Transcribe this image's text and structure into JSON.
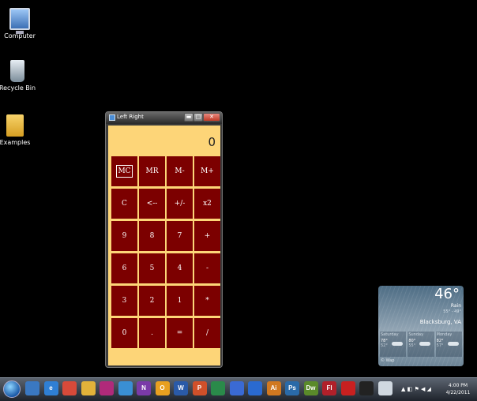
{
  "desktop": {
    "icons": [
      {
        "label": "Computer"
      },
      {
        "label": "Recycle Bin"
      },
      {
        "label": "Examples"
      }
    ]
  },
  "window": {
    "title": "Left Right",
    "min_symbol": "▬",
    "max_symbol": "□",
    "close_symbol": "✕",
    "display_value": "0",
    "keys": [
      "MC",
      "MR",
      "M-",
      "M+",
      "C",
      "<--",
      "+/-",
      "x2",
      "9",
      "8",
      "7",
      "+",
      "6",
      "5",
      "4",
      "-",
      "3",
      "2",
      "1",
      "*",
      "0",
      ".",
      "=",
      "/"
    ],
    "colors": {
      "background": "#fdd578",
      "key": "#7c0000",
      "key_text": "#ffffff"
    }
  },
  "weather": {
    "temperature": "46°",
    "condition": "Rain",
    "hi_lo": "55° - 49°",
    "city": "Blacksburg, VA",
    "days": [
      {
        "name": "Saturday",
        "hi": "78°",
        "lo": "52°"
      },
      {
        "name": "Sunday",
        "hi": "80°",
        "lo": "55°"
      },
      {
        "name": "Monday",
        "hi": "82°",
        "lo": "57°"
      }
    ],
    "brand": "© Wap"
  },
  "taskbar": {
    "apps": [
      {
        "icon": "explorer-icon",
        "label": "",
        "color": "#3a78c2"
      },
      {
        "icon": "ie-icon",
        "label": "e",
        "color": "#2f7fd4"
      },
      {
        "icon": "chrome-icon",
        "label": "",
        "color": "#d84a3a"
      },
      {
        "icon": "folder-icon",
        "label": "",
        "color": "#e2b23a"
      },
      {
        "icon": "app-icon",
        "label": "",
        "color": "#b02a7a"
      },
      {
        "icon": "media-icon",
        "label": "",
        "color": "#3a8fd4"
      },
      {
        "icon": "onenote-icon",
        "label": "N",
        "color": "#7a3aa8"
      },
      {
        "icon": "outlook-icon",
        "label": "O",
        "color": "#e8a020"
      },
      {
        "icon": "word-icon",
        "label": "W",
        "color": "#2a5aa8"
      },
      {
        "icon": "powerpoint-icon",
        "label": "P",
        "color": "#d0502a"
      },
      {
        "icon": "excel-icon",
        "label": "",
        "color": "#2a8a4a"
      },
      {
        "icon": "link-icon",
        "label": "",
        "color": "#3a6ad4"
      },
      {
        "icon": "globe-icon",
        "label": "",
        "color": "#2a6ad0"
      },
      {
        "icon": "illustrator-icon",
        "label": "Ai",
        "color": "#d07820"
      },
      {
        "icon": "photoshop-icon",
        "label": "Ps",
        "color": "#2a6aa8"
      },
      {
        "icon": "dreamweaver-icon",
        "label": "Dw",
        "color": "#5a8a2a"
      },
      {
        "icon": "flash-icon",
        "label": "Fl",
        "color": "#b0202a"
      },
      {
        "icon": "pin-icon",
        "label": "",
        "color": "#c82020"
      },
      {
        "icon": "cmd-icon",
        "label": "",
        "color": "#222222"
      },
      {
        "icon": "java-icon",
        "label": "",
        "color": "#d0d8e0"
      }
    ],
    "time": "4:00 PM",
    "date": "4/22/2011",
    "tray_symbols": "▲ ◧ ⚑ ◀ ◢"
  }
}
